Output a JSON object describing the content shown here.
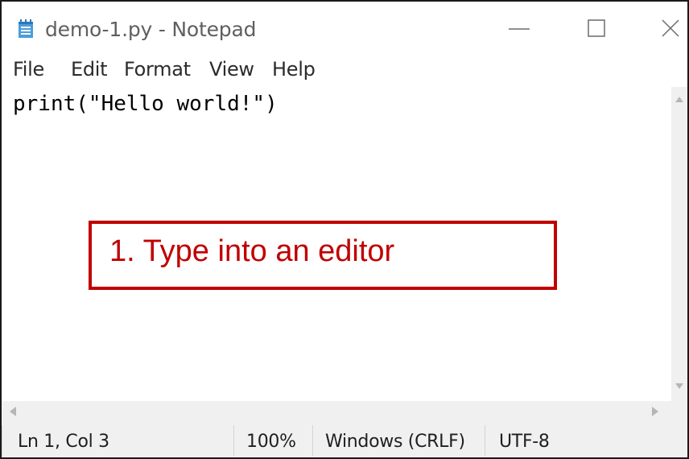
{
  "window": {
    "title": "demo-1.py - Notepad",
    "app_icon": "notepad-icon",
    "controls": {
      "minimize_icon": "minimize-icon",
      "maximize_icon": "maximize-icon",
      "close_icon": "close-icon"
    }
  },
  "menu": {
    "items": [
      {
        "label": "File"
      },
      {
        "label": "Edit"
      },
      {
        "label": "Format"
      },
      {
        "label": "View"
      },
      {
        "label": "Help"
      }
    ]
  },
  "editor": {
    "content": "print(\"Hello world!\")"
  },
  "callout": {
    "text": "1. Type into an editor",
    "color": "#c00000"
  },
  "status": {
    "position": "Ln 1, Col 3",
    "zoom": "100%",
    "line_endings": "Windows (CRLF)",
    "encoding": "UTF-8"
  }
}
